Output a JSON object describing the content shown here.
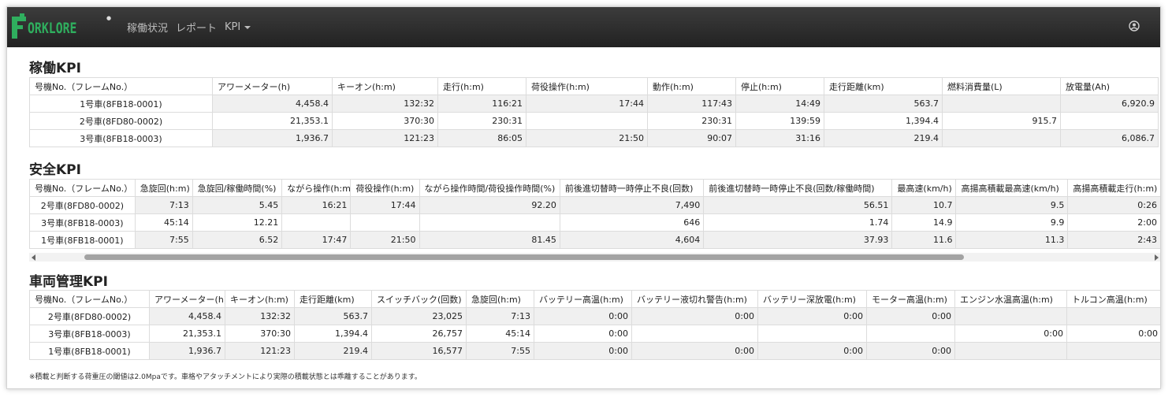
{
  "navbar": {
    "logo_text": "ORKLORE",
    "logo_mark": "F",
    "nav_items": [
      "稼働状況",
      "レポート",
      "KPI"
    ],
    "user_icon": "user-circle-icon"
  },
  "operation_kpi": {
    "title": "稼働KPI",
    "headers": [
      "号機No.（フレームNo.）",
      "アワーメーター(h)",
      "キーオン(h:m)",
      "走行(h:m)",
      "荷役操作(h:m)",
      "動作(h:m)",
      "停止(h:m)",
      "走行距離(km)",
      "燃料消費量(L)",
      "放電量(Ah)"
    ],
    "rows": [
      [
        "1号車(8FB18-0001)",
        "4,458.4",
        "132:32",
        "116:21",
        "17:44",
        "117:43",
        "14:49",
        "563.7",
        "",
        "6,920.9"
      ],
      [
        "2号車(8FD80-0002)",
        "21,353.1",
        "370:30",
        "230:31",
        "",
        "230:31",
        "139:59",
        "1,394.4",
        "915.7",
        ""
      ],
      [
        "3号車(8FB18-0003)",
        "1,936.7",
        "121:23",
        "86:05",
        "21:50",
        "90:07",
        "31:16",
        "219.4",
        "",
        "6,086.7"
      ]
    ]
  },
  "safety_kpi": {
    "title": "安全KPI",
    "headers": [
      "号機No.（フレームNo.）",
      "急旋回(h:m)",
      "急旋回/稼働時間(%)",
      "ながら操作(h:m)",
      "荷役操作(h:m)",
      "ながら操作時間/荷役操作時間(%)",
      "前後進切替時一時停止不良(回数)",
      "前後進切替時一時停止不良(回数/稼働時間)",
      "最高速(km/h)",
      "高揚高積載最高速(km/h)",
      "高揚高積載走行(h:m)"
    ],
    "rows": [
      [
        "2号車(8FD80-0002)",
        "7:13",
        "5.45",
        "16:21",
        "17:44",
        "92.20",
        "7,490",
        "56.51",
        "10.7",
        "9.5",
        "0:26"
      ],
      [
        "3号車(8FB18-0003)",
        "45:14",
        "12.21",
        "",
        "",
        "",
        "646",
        "1.74",
        "14.9",
        "9.9",
        "2:00"
      ],
      [
        "1号車(8FB18-0001)",
        "7:55",
        "6.52",
        "17:47",
        "21:50",
        "81.45",
        "4,604",
        "37.93",
        "11.6",
        "11.3",
        "2:43"
      ]
    ]
  },
  "vehicle_kpi": {
    "title": "車両管理KPI",
    "headers": [
      "号機No.（フレームNo.）",
      "アワーメーター(h)",
      "キーオン(h:m)",
      "走行距離(km)",
      "スイッチバック(回数)",
      "急旋回(h:m)",
      "バッテリー高温(h:m)",
      "バッテリー液切れ警告(h:m)",
      "バッテリー深放電(h:m)",
      "モーター高温(h:m)",
      "エンジン水温高温(h:m)",
      "トルコン高温(h:m)"
    ],
    "rows": [
      [
        "2号車(8FD80-0002)",
        "4,458.4",
        "132:32",
        "563.7",
        "23,025",
        "7:13",
        "0:00",
        "0:00",
        "0:00",
        "0:00",
        "",
        ""
      ],
      [
        "3号車(8FB18-0003)",
        "21,353.1",
        "370:30",
        "1,394.4",
        "26,757",
        "45:14",
        "0:00",
        "",
        "",
        "",
        "0:00",
        "0:00"
      ],
      [
        "1号車(8FB18-0001)",
        "1,936.7",
        "121:23",
        "219.4",
        "16,577",
        "7:55",
        "0:00",
        "0:00",
        "0:00",
        "0:00",
        "",
        ""
      ]
    ]
  },
  "footnote": "※積載と判断する荷重圧の閾値は2.0Mpaです。車格やアタッチメントにより実際の積載状態とは乖離することがあります。",
  "colors": {
    "navbar": "#2b2b2b",
    "logo_green": "#2fae5e",
    "row_stripe": "#f0f0f0"
  }
}
